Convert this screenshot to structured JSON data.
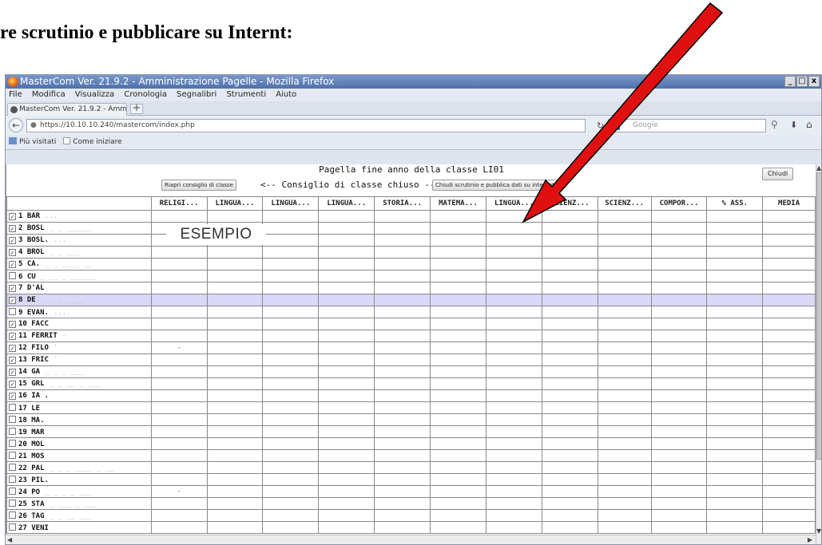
{
  "heading": "re scrutinio e pubblicare su Internt:",
  "window": {
    "title": "MasterCom Ver. 21.9.2 - Amministrazione Pagelle - Mozilla Firefox",
    "buttons": {
      "minimize": "_",
      "maximize": "□",
      "close": "x"
    }
  },
  "menu": [
    "File",
    "Modifica",
    "Visualizza",
    "Cronologia",
    "Segnalibri",
    "Strumenti",
    "Aiuto"
  ],
  "tab": {
    "label": "MasterCom Ver. 21.9.2 - Amministra...",
    "new_tab": "+"
  },
  "nav": {
    "url": "https://10.10.10.240/mastercom/index.php",
    "search_placeholder": "Google",
    "search_engine": "8"
  },
  "bookmarks": {
    "item1": "Più visitati",
    "item2": "Come iniziare"
  },
  "page": {
    "title": "Pagella fine anno della classe    LI01",
    "riapri_button": "Riapri consiglio di classe",
    "stato": "<-- Consiglio di classe chiuso -->",
    "chiudi_scrutinio_button": "Chiudi scrutinio e pubblica dati su internet",
    "chiudi_button": "Chiudi"
  },
  "watermark": "ESEMPIO",
  "table": {
    "columns": [
      "",
      "RELIGI...",
      "LINGUA...",
      "LINGUA...",
      "LINGUA...",
      "STORIA...",
      "MATEMA...",
      "LINGUA...",
      "SCIENZ...",
      "SCIENZ...",
      "COMPOR...",
      "% ASS.",
      "MEDIA"
    ],
    "rows": [
      {
        "name": "1 BAR",
        "rest": "...",
        "checked": true
      },
      {
        "name": "2 BOSL",
        "rest": "_ _ ______",
        "checked": true
      },
      {
        "name": "3 BOSL.",
        "rest": "...",
        "checked": true
      },
      {
        "name": "4 BROL",
        "rest": "_ _ ___",
        "checked": true
      },
      {
        "name": "5 CA.",
        "rest": "_ _ ____ __",
        "checked": true
      },
      {
        "name": "6 CU",
        "rest": "_ __ _ ______",
        "checked": false
      },
      {
        "name": "7 D'AL",
        "rest": "",
        "checked": true
      },
      {
        "name": "8 DE",
        "rest": "_ _ _ ____",
        "checked": true,
        "highlight": true
      },
      {
        "name": "9 EVAN.",
        "rest": "....",
        "checked": false
      },
      {
        "name": "10 FACC",
        "rest": "",
        "checked": true
      },
      {
        "name": "11 FERRIT",
        "rest": "-",
        "checked": true
      },
      {
        "name": "12 FILO",
        "rest": "'",
        "checked": true
      },
      {
        "name": "13 FRIC",
        "rest": "'",
        "checked": true
      },
      {
        "name": "14 GA",
        "rest": "_ _ _ ___",
        "checked": true
      },
      {
        "name": "15 GRL",
        "rest": "_ _ __ _ ___",
        "checked": true
      },
      {
        "name": "16 IA .",
        "rest": "",
        "checked": true
      },
      {
        "name": "17 LE",
        "rest": "",
        "checked": false
      },
      {
        "name": "18 MA.",
        "rest": "",
        "checked": false
      },
      {
        "name": "19 MAR",
        "rest": "",
        "checked": false
      },
      {
        "name": "20 MOL",
        "rest": "",
        "checked": false
      },
      {
        "name": "21 MOS",
        "rest": "",
        "checked": false
      },
      {
        "name": "22 PAL",
        "rest": "_ _ _ ____ _ __",
        "checked": false
      },
      {
        "name": "23 PIL.",
        "rest": "",
        "checked": false
      },
      {
        "name": "24 PO",
        "rest": "_ _ _ _ ___",
        "checked": false
      },
      {
        "name": "25 STA",
        "rest": "_ ___ _ ___",
        "checked": false
      },
      {
        "name": "26 TAG",
        "rest": "_ _ __ ___",
        "checked": false
      },
      {
        "name": "27 VENI",
        "rest": "",
        "checked": false
      }
    ],
    "religion_marks": {
      "12": "-",
      "24": "-"
    }
  },
  "colors": {
    "highlight_row": "#d9d8f7",
    "arrow": "#e01010",
    "titlebar": "#5a7cb8"
  }
}
